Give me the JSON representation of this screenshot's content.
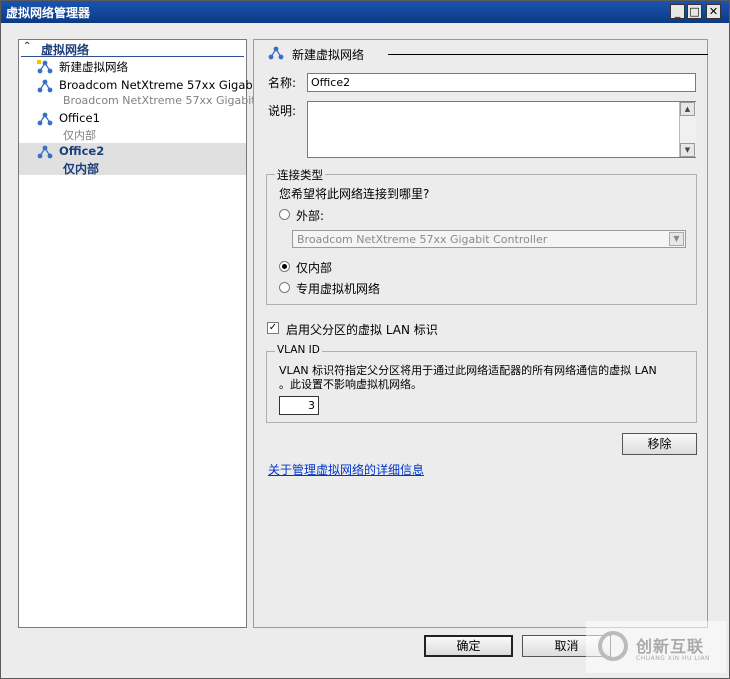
{
  "window": {
    "title": "虚拟网络管理器"
  },
  "tree": {
    "header": "虚拟网络",
    "items": [
      {
        "label": "新建虚拟网络",
        "sub": ""
      },
      {
        "label": "Broadcom NetXtreme 57xx Gigabit ...",
        "sub": "Broadcom NetXtreme 57xx Gigabit ..."
      },
      {
        "label": "Office1",
        "sub": "仅内部"
      },
      {
        "label": "Office2",
        "sub": "仅内部"
      }
    ]
  },
  "details": {
    "section_title": "新建虚拟网络",
    "name_label": "名称:",
    "name_value": "Office2",
    "desc_label": "说明:",
    "conn_group": "连接类型",
    "conn_question": "您希望将此网络连接到哪里?",
    "external_label": "外部:",
    "external_adapter": "Broadcom NetXtreme 57xx Gigabit Controller",
    "internal_label": "仅内部",
    "private_label": "专用虚拟机网络",
    "vlan_check_label": "启用父分区的虚拟 LAN 标识",
    "vlan_group": "VLAN ID",
    "vlan_desc_1": "VLAN 标识符指定父分区将用于通过此网络适配器的所有网络通信的虚拟 LAN",
    "vlan_desc_2": "。此设置不影响虚拟机网络。",
    "vlan_value": "3",
    "remove_label": "移除",
    "info_link": "关于管理虚拟网络的详细信息"
  },
  "footer": {
    "ok_label": "确定",
    "cancel_label": "取消"
  },
  "watermark": {
    "text": "创新互联",
    "sub": "CHUANG XIN HU LIAN"
  }
}
